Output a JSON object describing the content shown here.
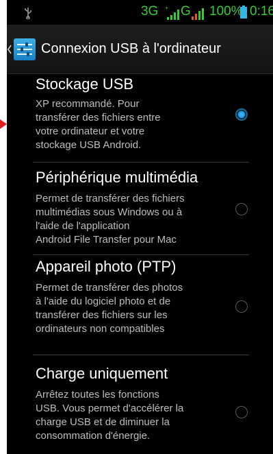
{
  "status_bar": {
    "network": "3G",
    "network_sub": "+",
    "data_type": "G",
    "battery_percent": "100%",
    "time": "0:16",
    "text_color": "#33cc33",
    "icons": [
      "usb-icon",
      "signal-icon",
      "signal-icon",
      "battery-icon"
    ]
  },
  "action_bar": {
    "title": "Connexion USB à l'ordinateur",
    "icon": "usb-settings-icon",
    "back_icon": "chevron-left-icon"
  },
  "options": [
    {
      "title": "Stockage USB",
      "description": [
        "XP recommandé. Pour",
        "transférer des fichiers entre",
        "votre ordinateur et votre",
        "stockage USB Android."
      ],
      "selected": true
    },
    {
      "title": "Périphérique multimédia",
      "description": [
        "Permet de transférer des fichiers",
        "multimédias sous Windows ou à",
        "l'aide de l'application",
        "Android File Transfer pour Mac"
      ],
      "selected": false
    },
    {
      "title": "Appareil photo (PTP)",
      "description": [
        "Permet de transférer des photos",
        "à l'aide du logiciel photo et de",
        "transférer des fichiers sur les",
        "ordinateurs non compatibles"
      ],
      "selected": false
    },
    {
      "title": "Charge uniquement",
      "description": [
        "Arrêtez toutes les fonctions",
        "USB. Vous permet d'accélérer la",
        "charge USB et de diminuer la",
        "consommation d'énergie."
      ],
      "selected": false
    }
  ],
  "colors": {
    "accent": "#33b5e5",
    "background": "#000000",
    "annotation_arrow": "#e02020"
  }
}
